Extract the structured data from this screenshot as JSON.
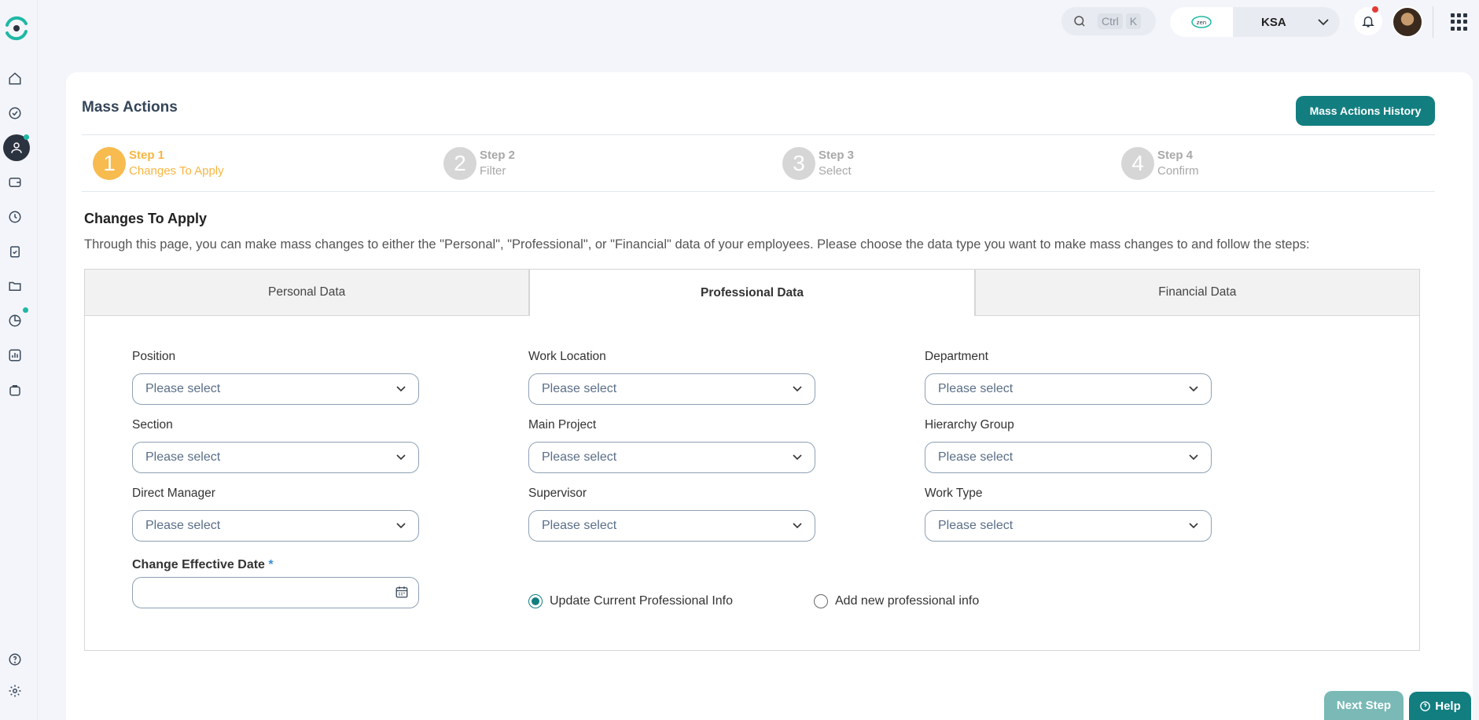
{
  "topbar": {
    "search_shortcut_ctrl": "Ctrl",
    "search_shortcut_key": "K",
    "company_logo_text": "zen",
    "country": "KSA"
  },
  "page": {
    "title": "Mass Actions",
    "history_button": "Mass Actions History"
  },
  "steps": [
    {
      "number": "1",
      "label": "Step 1",
      "name": "Changes To Apply",
      "active": true
    },
    {
      "number": "2",
      "label": "Step 2",
      "name": "Filter",
      "active": false
    },
    {
      "number": "3",
      "label": "Step 3",
      "name": "Select",
      "active": false
    },
    {
      "number": "4",
      "label": "Step 4",
      "name": "Confirm",
      "active": false
    }
  ],
  "section": {
    "title": "Changes To Apply",
    "description": "Through this page, you can make mass changes to either the \"Personal\", \"Professional\", or \"Financial\" data of your employees. Please choose the data type you want to make mass changes to and follow the steps:"
  },
  "tabs": [
    {
      "label": "Personal Data",
      "active": false
    },
    {
      "label": "Professional Data",
      "active": true
    },
    {
      "label": "Financial Data",
      "active": false
    }
  ],
  "fields": {
    "position": {
      "label": "Position",
      "placeholder": "Please select"
    },
    "work_location": {
      "label": "Work Location",
      "placeholder": "Please select"
    },
    "department": {
      "label": "Department",
      "placeholder": "Please select"
    },
    "section": {
      "label": "Section",
      "placeholder": "Please select"
    },
    "main_project": {
      "label": "Main Project",
      "placeholder": "Please select"
    },
    "hierarchy_group": {
      "label": "Hierarchy Group",
      "placeholder": "Please select"
    },
    "direct_manager": {
      "label": "Direct Manager",
      "placeholder": "Please select"
    },
    "supervisor": {
      "label": "Supervisor",
      "placeholder": "Please select"
    },
    "work_type": {
      "label": "Work Type",
      "placeholder": "Please select"
    }
  },
  "effective_date": {
    "label": "Change Effective Date",
    "required_mark": "*",
    "value": ""
  },
  "radios": {
    "update_current": {
      "label": "Update Current Professional Info",
      "checked": true
    },
    "add_new": {
      "label": "Add new professional info",
      "checked": false
    }
  },
  "footer": {
    "next_step": "Next Step",
    "help": "Help"
  },
  "colors": {
    "primary": "#127e80",
    "step_active": "#f7bb4f",
    "notification": "#e53935",
    "sidebar_dot": "#1fb8a5"
  }
}
